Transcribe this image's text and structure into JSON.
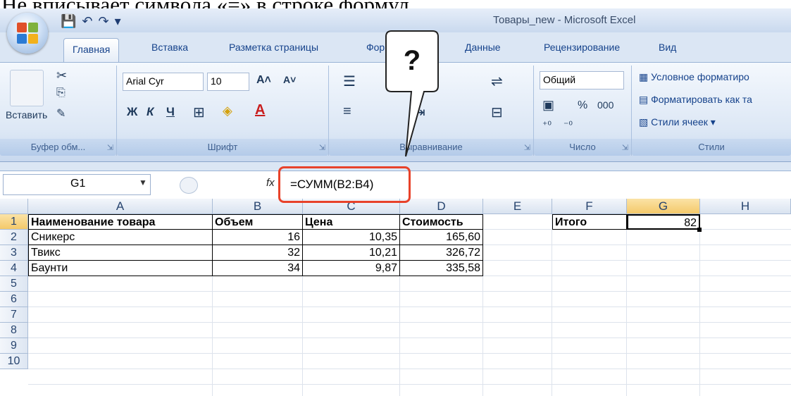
{
  "caption": "Нe вписывает символа «=» в строке формул.",
  "window": {
    "title": "Товары_new - Microsoft Excel",
    "qat": {
      "save": "💾",
      "undo": "↶",
      "redo": "↷",
      "more": "▾"
    }
  },
  "tabs": [
    "Главная",
    "Вставка",
    "Разметка страницы",
    "Формулы",
    "Данные",
    "Рецензирование",
    "Вид"
  ],
  "ribbon": {
    "clipboard": {
      "paste": "Вставить",
      "label": "Буфер обм...",
      "launcher": "⇲"
    },
    "font": {
      "name": "Arial Cyr",
      "size": "10",
      "grow": "A˄",
      "shrink": "A˅",
      "bold": "Ж",
      "italic": "К",
      "underline": "Ч",
      "label": "Шрифт",
      "launcher": "⇲"
    },
    "alignment": {
      "label": "Выравнивание",
      "launcher": "⇲"
    },
    "number": {
      "format": "Общий",
      "percent": "%",
      "thousands": "000",
      "label": "Число",
      "launcher": "⇲"
    },
    "styles": {
      "conditional": "Условное форматиро",
      "as_table": "Форматировать как та",
      "cell_styles": "Стили ячеек ▾",
      "label": "Стили"
    }
  },
  "callout": {
    "text": "?"
  },
  "formula_bar": {
    "name_box": "G1",
    "fx": "fx",
    "formula": "=СУММ(B2:B4)"
  },
  "columns": [
    "A",
    "B",
    "C",
    "D",
    "E",
    "F",
    "G",
    "H"
  ],
  "rows": [
    "1",
    "2",
    "3",
    "4",
    "5",
    "6",
    "7",
    "8",
    "9",
    "10"
  ],
  "sheet": {
    "headers": {
      "a": "Наименование товара",
      "b": "Объем",
      "c": "Цена",
      "d": "Стоимость"
    },
    "items": [
      {
        "a": "Сникерс",
        "b": "16",
        "c": "10,35",
        "d": "165,60"
      },
      {
        "a": "Твикс",
        "b": "32",
        "c": "10,21",
        "d": "326,72"
      },
      {
        "a": "Баунти",
        "b": "34",
        "c": "9,87",
        "d": "335,58"
      }
    ],
    "total_label": "Итого",
    "total_value": "82"
  },
  "colors": {
    "accent": "#15428b",
    "callout_border": "#e8422a",
    "selection": "#f4c96a"
  }
}
